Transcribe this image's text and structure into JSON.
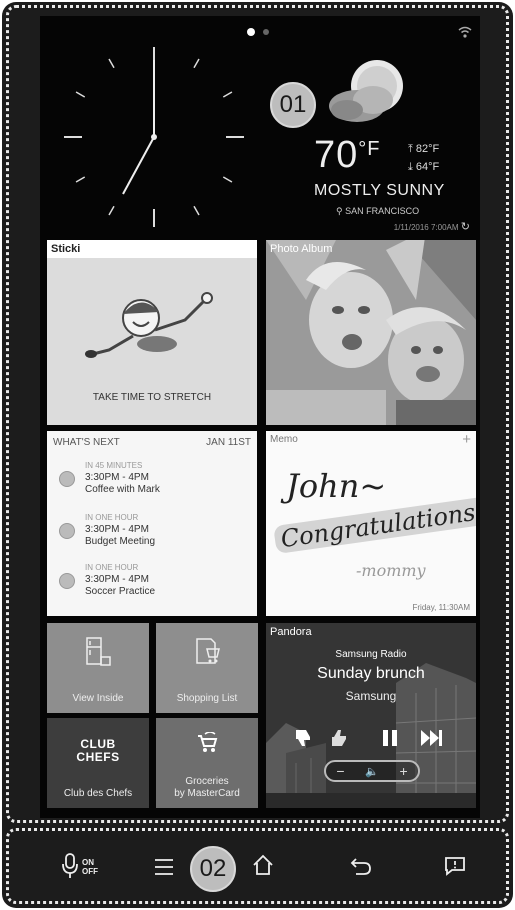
{
  "callouts": {
    "weather": "01",
    "navbar": "02"
  },
  "weather": {
    "temperature": "70",
    "unit": "°F",
    "high": "82°F",
    "low": "64°F",
    "condition": "MOSTLY SUNNY",
    "location": "SAN FRANCISCO",
    "updated": "1/11/2016 7:00AM",
    "icon": "partly-sunny-icon"
  },
  "tiles": {
    "sticki": {
      "title": "Sticki",
      "text": "TAKE TIME TO STRETCH"
    },
    "photo_album": {
      "title": "Photo Album"
    },
    "whats_next": {
      "title": "WHAT'S NEXT",
      "date": "JAN 11ST",
      "events": [
        {
          "when": "IN 45 MINUTES",
          "time": "3:30PM - 4PM",
          "title": "Coffee with Mark"
        },
        {
          "when": "IN ONE HOUR",
          "time": "3:30PM - 4PM",
          "title": "Budget Meeting"
        },
        {
          "when": "IN ONE HOUR",
          "time": "3:30PM - 4PM",
          "title": "Soccer Practice"
        }
      ]
    },
    "memo": {
      "title": "Memo",
      "line1": "John~",
      "line2": "Congratulations!",
      "line3": "-mommy",
      "date": "Friday, 11:30AM"
    },
    "view_inside": {
      "label": "View Inside"
    },
    "shopping_list": {
      "label": "Shopping List"
    },
    "club_chefs": {
      "logo_line1": "CLUB",
      "logo_line2": "CHEFS",
      "label": "Club des Chefs"
    },
    "groceries": {
      "label_line1": "Groceries",
      "label_line2": "by MasterCard"
    },
    "pandora": {
      "title": "Pandora",
      "station": "Samsung Radio",
      "song": "Sunday brunch",
      "artist": "Samsung"
    }
  },
  "navbar": {
    "on": "ON",
    "off": "OFF"
  }
}
